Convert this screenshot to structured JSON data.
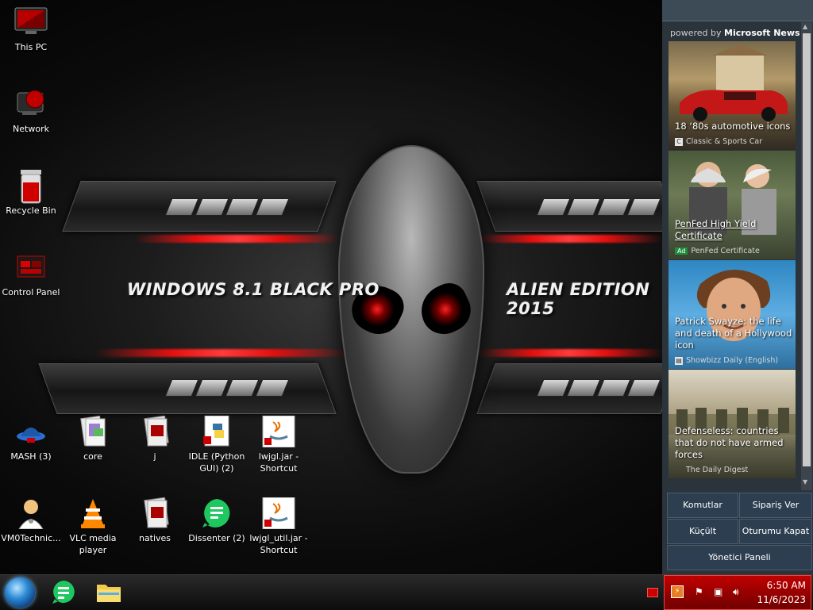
{
  "wallpaper": {
    "left_text": "WINDOWS 8.1 BLACK PRO",
    "right_text": "ALIEN EDITION 2015"
  },
  "desktop_icons": [
    {
      "label": "This PC",
      "icon": "computer-icon"
    },
    {
      "label": "Network",
      "icon": "network-icon"
    },
    {
      "label": "Recycle Bin",
      "icon": "recycle-bin-icon"
    },
    {
      "label": "Control Panel",
      "icon": "control-panel-icon"
    },
    {
      "label": "MASH (3)",
      "icon": "mash-icon"
    },
    {
      "label": "core",
      "icon": "folder-icon"
    },
    {
      "label": "j",
      "icon": "folder-icon"
    },
    {
      "label": "IDLE (Python GUI) (2)",
      "icon": "python-icon"
    },
    {
      "label": "lwjgl.jar - Shortcut",
      "icon": "java-icon"
    },
    {
      "label": "VM0Technic...",
      "icon": "doctor-icon"
    },
    {
      "label": "VLC media player",
      "icon": "vlc-icon"
    },
    {
      "label": "natives",
      "icon": "folder-icon"
    },
    {
      "label": "Dissenter (2)",
      "icon": "dissenter-icon"
    },
    {
      "label": "lwjgl_util.jar - Shortcut",
      "icon": "java-icon"
    }
  ],
  "news_panel": {
    "powered_prefix": "powered by",
    "powered_brand": "Microsoft News",
    "cards": [
      {
        "title": "18 ‘80s automotive icons",
        "source": "Classic & Sports Car",
        "ad": false,
        "badge": "C"
      },
      {
        "title": "PenFed High Yield Certificate",
        "source": "PenFed Certificate",
        "ad": true,
        "badge": "Ad"
      },
      {
        "title": "Patrick Swayze: the life and death of a Hollywood icon",
        "source": "Showbizz Daily (English)",
        "ad": false,
        "badge": ""
      },
      {
        "title": "Defenseless: countries that do not have armed forces",
        "source": "The Daily Digest",
        "ad": false,
        "badge": ""
      }
    ],
    "actions": {
      "commands": "Komutlar",
      "order": "Sipariş Ver",
      "minimize": "Küçült",
      "logout": "Oturumu Kapat",
      "admin_panel": "Yönetici Paneli"
    }
  },
  "taskbar": {
    "time": "6:50 AM",
    "date": "11/6/2023"
  },
  "colors": {
    "accent_red": "#c00000",
    "panel_bg": "#2b333b",
    "button_bg": "#2c3e50"
  }
}
